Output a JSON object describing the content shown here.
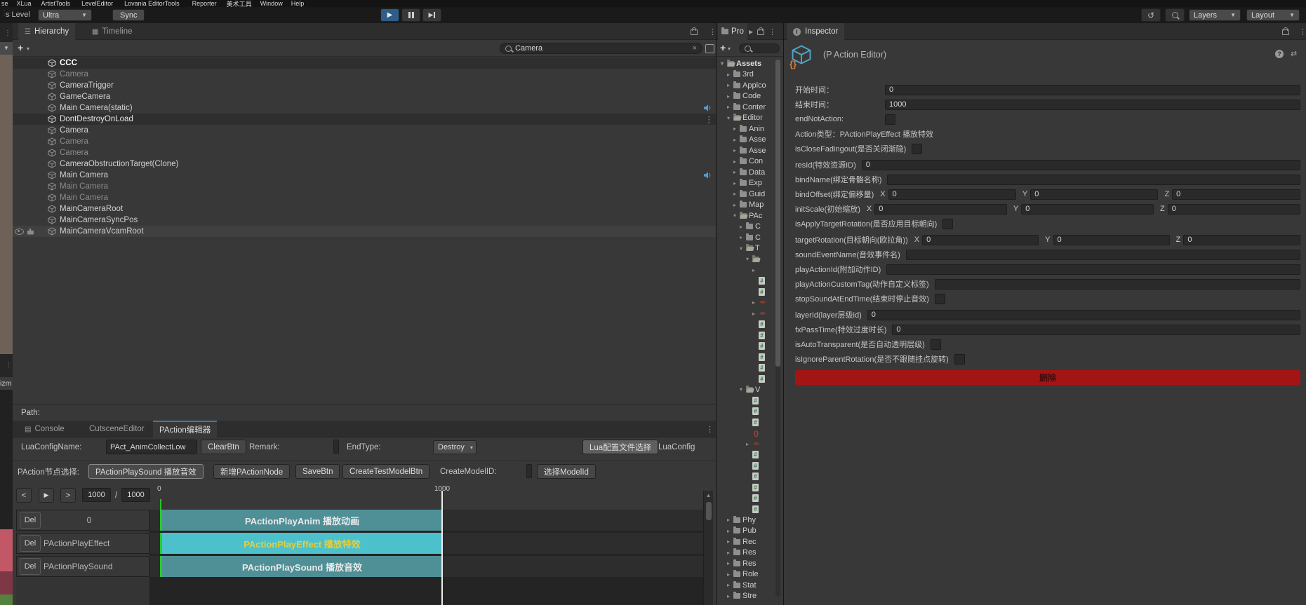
{
  "menu": {
    "items": [
      "se",
      "XLua",
      "ArtistTools",
      "LevelEditor",
      "Lovania EditorTools",
      "Reporter",
      "美术工具",
      "Window",
      "Help"
    ]
  },
  "toolbar": {
    "level_label": "s Level",
    "quality_value": "Ultra",
    "sync_label": "Sync",
    "layers_label": "Layers",
    "layout_label": "Layout"
  },
  "left_strip": {
    "gizmos_label": "izm"
  },
  "hierarchy": {
    "tab_hierarchy": "Hierarchy",
    "tab_timeline": "Timeline",
    "search_value": "Camera",
    "path_label": "Path:",
    "rows": [
      {
        "label": "CCC",
        "style": "scene",
        "bold": true
      },
      {
        "label": "Camera",
        "style": "dim"
      },
      {
        "label": "CameraTrigger",
        "style": "normal"
      },
      {
        "label": "GameCamera",
        "style": "normal"
      },
      {
        "label": "Main Camera(static)",
        "style": "normal",
        "audio": true
      },
      {
        "label": "DontDestroyOnLoad",
        "style": "scene",
        "kebab": true
      },
      {
        "label": "Camera",
        "style": "normal"
      },
      {
        "label": "Camera",
        "style": "dim"
      },
      {
        "label": "Camera",
        "style": "dim"
      },
      {
        "label": "CameraObstructionTarget(Clone)",
        "style": "normal"
      },
      {
        "label": "Main Camera",
        "style": "normal",
        "audio": true
      },
      {
        "label": "Main Camera",
        "style": "dim"
      },
      {
        "label": "Main Camera",
        "style": "dim"
      },
      {
        "label": "MainCameraRoot",
        "style": "normal"
      },
      {
        "label": "MainCameraSyncPos",
        "style": "normal"
      },
      {
        "label": "MainCameraVcamRoot",
        "style": "selected",
        "eye": true
      }
    ]
  },
  "project": {
    "tab_label": "Pro",
    "tree": [
      {
        "label": "Assets",
        "depth": 0,
        "icon": "folder-open",
        "arrow": "open",
        "bold": true
      },
      {
        "label": "3rd",
        "depth": 1,
        "icon": "folder",
        "arrow": "closed"
      },
      {
        "label": "Applco",
        "depth": 1,
        "icon": "folder",
        "arrow": "closed"
      },
      {
        "label": "Code",
        "depth": 1,
        "icon": "folder",
        "arrow": "closed"
      },
      {
        "label": "Conter",
        "depth": 1,
        "icon": "folder",
        "arrow": "closed"
      },
      {
        "label": "Editor",
        "depth": 1,
        "icon": "folder-open",
        "arrow": "open"
      },
      {
        "label": "Anin",
        "depth": 2,
        "icon": "folder",
        "arrow": "closed"
      },
      {
        "label": "Asse",
        "depth": 2,
        "icon": "folder",
        "arrow": "closed"
      },
      {
        "label": "Asse",
        "depth": 2,
        "icon": "folder",
        "arrow": "closed"
      },
      {
        "label": "Con",
        "depth": 2,
        "icon": "folder",
        "arrow": "closed"
      },
      {
        "label": "Data",
        "depth": 2,
        "icon": "folder",
        "arrow": "closed"
      },
      {
        "label": "Exp",
        "depth": 2,
        "icon": "folder",
        "arrow": "closed"
      },
      {
        "label": "Guid",
        "depth": 2,
        "icon": "folder",
        "arrow": "closed"
      },
      {
        "label": "Map",
        "depth": 2,
        "icon": "folder",
        "arrow": "closed"
      },
      {
        "label": "PAc",
        "depth": 2,
        "icon": "folder-open",
        "arrow": "open"
      },
      {
        "label": "C",
        "depth": 3,
        "icon": "folder",
        "arrow": "closed"
      },
      {
        "label": "C",
        "depth": 3,
        "icon": "folder",
        "arrow": "closed"
      },
      {
        "label": "T",
        "depth": 3,
        "icon": "folder-open",
        "arrow": "open"
      },
      {
        "label": "",
        "depth": 4,
        "icon": "folder-open",
        "arrow": "open"
      },
      {
        "label": "",
        "depth": 5,
        "icon": "none",
        "arrow": "closed"
      },
      {
        "label": "",
        "depth": 5,
        "icon": "script",
        "arrow": "none"
      },
      {
        "label": "",
        "depth": 5,
        "icon": "script",
        "arrow": "none"
      },
      {
        "label": "",
        "depth": 5,
        "icon": "shader",
        "arrow": "closed"
      },
      {
        "label": "",
        "depth": 5,
        "icon": "shader",
        "arrow": "closed"
      },
      {
        "label": "",
        "depth": 5,
        "icon": "script",
        "arrow": "none"
      },
      {
        "label": "",
        "depth": 5,
        "icon": "script",
        "arrow": "none"
      },
      {
        "label": "",
        "depth": 5,
        "icon": "script",
        "arrow": "none"
      },
      {
        "label": "",
        "depth": 5,
        "icon": "script",
        "arrow": "none"
      },
      {
        "label": "",
        "depth": 5,
        "icon": "script",
        "arrow": "none"
      },
      {
        "label": "",
        "depth": 5,
        "icon": "script",
        "arrow": "none"
      },
      {
        "label": "V",
        "depth": 3,
        "icon": "folder-open",
        "arrow": "open"
      },
      {
        "label": "",
        "depth": 4,
        "icon": "script",
        "arrow": "none"
      },
      {
        "label": "",
        "depth": 4,
        "icon": "script",
        "arrow": "none"
      },
      {
        "label": "",
        "depth": 4,
        "icon": "script",
        "arrow": "none"
      },
      {
        "label": "",
        "depth": 4,
        "icon": "json",
        "arrow": "none"
      },
      {
        "label": "",
        "depth": 4,
        "icon": "shader",
        "arrow": "closed"
      },
      {
        "label": "",
        "depth": 4,
        "icon": "script",
        "arrow": "none"
      },
      {
        "label": "",
        "depth": 4,
        "icon": "script",
        "arrow": "none"
      },
      {
        "label": "",
        "depth": 4,
        "icon": "script",
        "arrow": "none"
      },
      {
        "label": "",
        "depth": 4,
        "icon": "script",
        "arrow": "none"
      },
      {
        "label": "",
        "depth": 4,
        "icon": "script",
        "arrow": "none"
      },
      {
        "label": "",
        "depth": 4,
        "icon": "script",
        "arrow": "none"
      },
      {
        "label": "Phy",
        "depth": 1,
        "icon": "folder",
        "arrow": "closed"
      },
      {
        "label": "Pub",
        "depth": 1,
        "icon": "folder",
        "arrow": "closed"
      },
      {
        "label": "Rec",
        "depth": 1,
        "icon": "folder",
        "arrow": "closed"
      },
      {
        "label": "Res",
        "depth": 1,
        "icon": "folder",
        "arrow": "closed"
      },
      {
        "label": "Res",
        "depth": 1,
        "icon": "folder",
        "arrow": "closed"
      },
      {
        "label": "Role",
        "depth": 1,
        "icon": "folder",
        "arrow": "closed"
      },
      {
        "label": "Stat",
        "depth": 1,
        "icon": "folder",
        "arrow": "closed"
      },
      {
        "label": "Stre",
        "depth": 1,
        "icon": "folder",
        "arrow": "closed"
      }
    ]
  },
  "inspector": {
    "tab_label": "Inspector",
    "title": "(P Action Editor)",
    "fields": [
      {
        "type": "input",
        "label": "开始时间：",
        "value": "0",
        "align": true
      },
      {
        "type": "input",
        "label": "结束时间：",
        "value": "1000",
        "align": true
      },
      {
        "type": "checkbox",
        "label": "endNotAction:",
        "align": true
      },
      {
        "type": "text",
        "label": "Action类型：PActionPlayEffect 播放特效"
      },
      {
        "type": "checkbox",
        "label": "isCloseFadingout(是否关闭渐隐)"
      },
      {
        "type": "input",
        "label": "resId(特效资源ID)",
        "value": "0",
        "gap": true
      },
      {
        "type": "input",
        "label": "bindName(绑定骨骼名称)",
        "value": ""
      },
      {
        "type": "vector3",
        "label": "bindOffset(绑定偏移量)",
        "axes": [
          "X",
          "Y",
          "Z"
        ],
        "x": "0",
        "y": "0",
        "z": "0"
      },
      {
        "type": "vector3",
        "label": "initScale(初始缩放)",
        "axes": [
          "X",
          "Y",
          "Z"
        ],
        "x": "0",
        "y": "0",
        "z": "0"
      },
      {
        "type": "checkbox",
        "label": "isApplyTargetRotation(是否应用目标朝向)"
      },
      {
        "type": "vector3",
        "label": "targetRotation(目标朝向(欧拉角))",
        "axes": [
          "X",
          "Y",
          "Z"
        ],
        "x": "0",
        "y": "0",
        "z": "0",
        "gap": true
      },
      {
        "type": "input",
        "label": "soundEventName(音效事件名)",
        "value": ""
      },
      {
        "type": "input",
        "label": "playActionId(附加动作ID)",
        "value": ""
      },
      {
        "type": "input",
        "label": "playActionCustomTag(动作自定义标签)",
        "value": ""
      },
      {
        "type": "checkbox",
        "label": "stopSoundAtEndTime(结束时停止音效)"
      },
      {
        "type": "input",
        "label": "layerId(layer层级id)",
        "value": "0",
        "gap": true
      },
      {
        "type": "input",
        "label": "fxPassTime(特效过度时长)",
        "value": "0"
      },
      {
        "type": "checkbox",
        "label": "isAutoTransparent(是否自动透明层级)"
      },
      {
        "type": "checkbox",
        "label": "isIgnoreParentRotation(是否不跟随挂点旋转)"
      },
      {
        "type": "button",
        "label": "删除",
        "color": "#a31515"
      }
    ]
  },
  "bottom": {
    "tabs": [
      {
        "label": "Console"
      },
      {
        "label": "CutsceneEditor"
      },
      {
        "label": "PAction编辑器"
      }
    ],
    "lua": {
      "name_label": "LuaConfigName:",
      "name_value": "PAct_AnimCollectLow",
      "clear_label": "ClearBtn",
      "remark_label": "Remark:",
      "endtype_label": "EndType:",
      "endtype_value": "Destroy",
      "file_select_label": "Lua配置文件选择",
      "luaconfig_label": "LuaConfig"
    },
    "node": {
      "select_label": "PAction节点选择:",
      "sound_btn": "PActionPlaySound 播放音效",
      "add_btn": "新增PActionNode",
      "save_btn": "SaveBtn",
      "create_test_btn": "CreateTestModelBtn",
      "create_model_label": "CreateModelID:",
      "select_model_btn": "选择ModelId"
    },
    "timeline": {
      "prev": "<",
      "next": ">",
      "current": "1000",
      "divider": "/",
      "total": "1000",
      "ruler_start": "0",
      "ruler_end": "1000"
    },
    "tracks": [
      {
        "del": "Del",
        "name": "0",
        "name_align": "center",
        "bar_label": "PActionPlayAnim 播放动画",
        "bar_color": "#4f8f96",
        "text_color": "#e9e9e9"
      },
      {
        "del": "Del",
        "name": "PActionPlayEffect",
        "name_align": "left",
        "bar_label": "PActionPlayEffect 播放特效",
        "bar_color": "#4cc1cc",
        "text_color": "#e5cf3d"
      },
      {
        "del": "Del",
        "name": "PActionPlaySound",
        "name_align": "left",
        "bar_label": "PActionPlaySound 播放音效",
        "bar_color": "#4f8f96",
        "text_color": "#e9e9e9"
      }
    ]
  }
}
